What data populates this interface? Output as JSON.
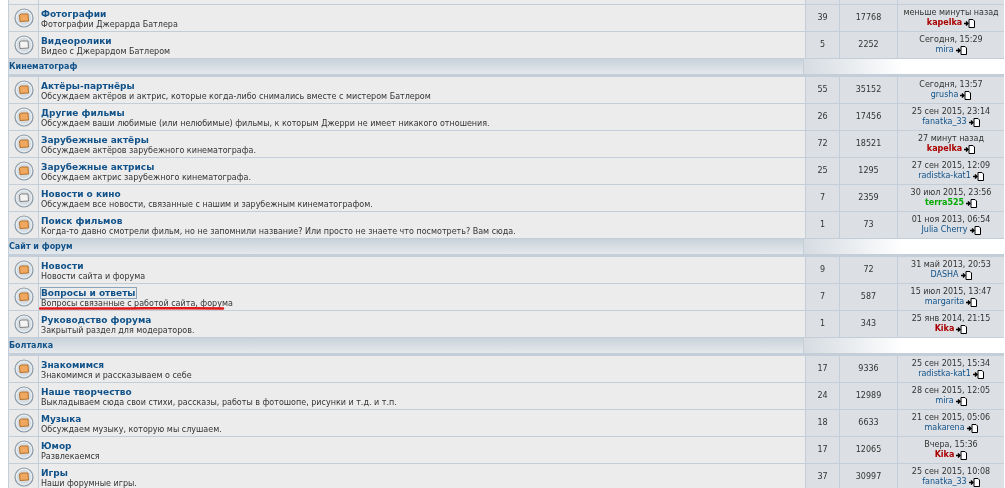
{
  "sections": [
    {
      "forums": [
        {
          "name": "Фотографии",
          "description": "Фотографии Джерарда Батлера",
          "unread": true,
          "focused": false,
          "underlined": false,
          "topics": "39",
          "posts": "17768",
          "last_time": "меньше минуты назад",
          "last_user": {
            "name": "kapelka",
            "kind": "admin"
          }
        },
        {
          "name": "Видеоролики",
          "description": "Видео с Джерардом Батлером",
          "unread": false,
          "focused": false,
          "underlined": false,
          "topics": "5",
          "posts": "2252",
          "last_time": "Сегодня, 15:29",
          "last_user": {
            "name": "mira",
            "kind": "member"
          }
        }
      ]
    },
    {
      "title": "Кинематограф",
      "forums": [
        {
          "name": "Актёры-партнёры",
          "description": "Обсуждаем актёров и актрис, которые когда-либо снимались вместе с мистером Батлером",
          "unread": true,
          "focused": false,
          "underlined": false,
          "topics": "55",
          "posts": "35152",
          "last_time": "Сегодня, 13:57",
          "last_user": {
            "name": "grusha",
            "kind": "member"
          }
        },
        {
          "name": "Другие фильмы",
          "description": "Обсуждаем ваши любимые (или нелюбимые) фильмы, к которым Джерри не имеет никакого отношения.",
          "unread": true,
          "focused": false,
          "underlined": false,
          "topics": "26",
          "posts": "17456",
          "last_time": "25 сен 2015, 23:14",
          "last_user": {
            "name": "fanatka_33",
            "kind": "member"
          }
        },
        {
          "name": "Зарубежные актёры",
          "description": "Обсуждаем актёров зарубежного кинематографа.",
          "unread": true,
          "focused": false,
          "underlined": false,
          "topics": "72",
          "posts": "18521",
          "last_time": "27 минут назад",
          "last_user": {
            "name": "kapelka",
            "kind": "admin"
          }
        },
        {
          "name": "Зарубежные актрисы",
          "description": "Обсуждаем актрис зарубежного кинематографа.",
          "unread": true,
          "focused": false,
          "underlined": false,
          "topics": "25",
          "posts": "1295",
          "last_time": "27 сен 2015, 12:09",
          "last_user": {
            "name": "radistka-kat1",
            "kind": "member"
          }
        },
        {
          "name": "Новости о кино",
          "description": "Обсуждаем все новости, связанные с нашим и зарубежным кинематографом.",
          "unread": false,
          "focused": false,
          "underlined": false,
          "topics": "7",
          "posts": "2359",
          "last_time": "30 июл 2015, 23:56",
          "last_user": {
            "name": "terra525",
            "kind": "moderator"
          }
        },
        {
          "name": "Поиск фильмов",
          "description": "Когда-то давно смотрели фильм, но не запомнили название? Или просто не знаете что посмотреть? Вам сюда.",
          "unread": true,
          "focused": false,
          "underlined": false,
          "topics": "1",
          "posts": "73",
          "last_time": "01 ноя 2013, 06:54",
          "last_user": {
            "name": "Julia Cherry",
            "kind": "member"
          }
        }
      ]
    },
    {
      "title": "Сайт и форум",
      "forums": [
        {
          "name": "Новости",
          "description": "Новости сайта и форума",
          "unread": true,
          "focused": false,
          "underlined": false,
          "topics": "9",
          "posts": "72",
          "last_time": "31 май 2013, 20:53",
          "last_user": {
            "name": "DASHA",
            "kind": "member"
          }
        },
        {
          "name": "Вопросы и ответы",
          "description": "Вопросы связанные с работой сайта, форума",
          "unread": true,
          "focused": true,
          "underlined": true,
          "topics": "7",
          "posts": "587",
          "last_time": "15 июл 2015, 13:47",
          "last_user": {
            "name": "margarita",
            "kind": "member"
          }
        },
        {
          "name": "Руководство форума",
          "description": "Закрытый раздел для модераторов.",
          "unread": false,
          "focused": false,
          "underlined": false,
          "topics": "1",
          "posts": "343",
          "last_time": "25 янв 2014, 21:15",
          "last_user": {
            "name": "Kika",
            "kind": "admin"
          }
        }
      ]
    },
    {
      "title": "Болталка",
      "forums": [
        {
          "name": "Знакомимся",
          "description": "Знакомимся и рассказываем о себе",
          "unread": true,
          "focused": false,
          "underlined": false,
          "topics": "17",
          "posts": "9336",
          "last_time": "25 сен 2015, 15:34",
          "last_user": {
            "name": "radistka-kat1",
            "kind": "member"
          }
        },
        {
          "name": "Наше творчество",
          "description": "Выкладываем сюда свои стихи, рассказы, работы в фотошопе, рисунки и т.д. и т.п.",
          "unread": true,
          "focused": false,
          "underlined": false,
          "topics": "24",
          "posts": "12989",
          "last_time": "28 сен 2015, 12:05",
          "last_user": {
            "name": "mira",
            "kind": "member"
          }
        },
        {
          "name": "Музыка",
          "description": "Обсуждаем музыку, которую мы слушаем.",
          "unread": true,
          "focused": false,
          "underlined": false,
          "topics": "18",
          "posts": "6633",
          "last_time": "21 сен 2015, 05:06",
          "last_user": {
            "name": "makarena",
            "kind": "member"
          }
        },
        {
          "name": "Юмор",
          "description": "Развлекаемся",
          "unread": true,
          "focused": false,
          "underlined": false,
          "topics": "17",
          "posts": "12065",
          "last_time": "Вчера, 15:36",
          "last_user": {
            "name": "Kika",
            "kind": "admin"
          }
        },
        {
          "name": "Игры",
          "description": "Наши форумные игры.",
          "unread": true,
          "focused": false,
          "underlined": false,
          "topics": "37",
          "posts": "30997",
          "last_time": "25 сен 2015, 10:08",
          "last_user": {
            "name": "fanatka_33",
            "kind": "member"
          }
        }
      ]
    }
  ]
}
